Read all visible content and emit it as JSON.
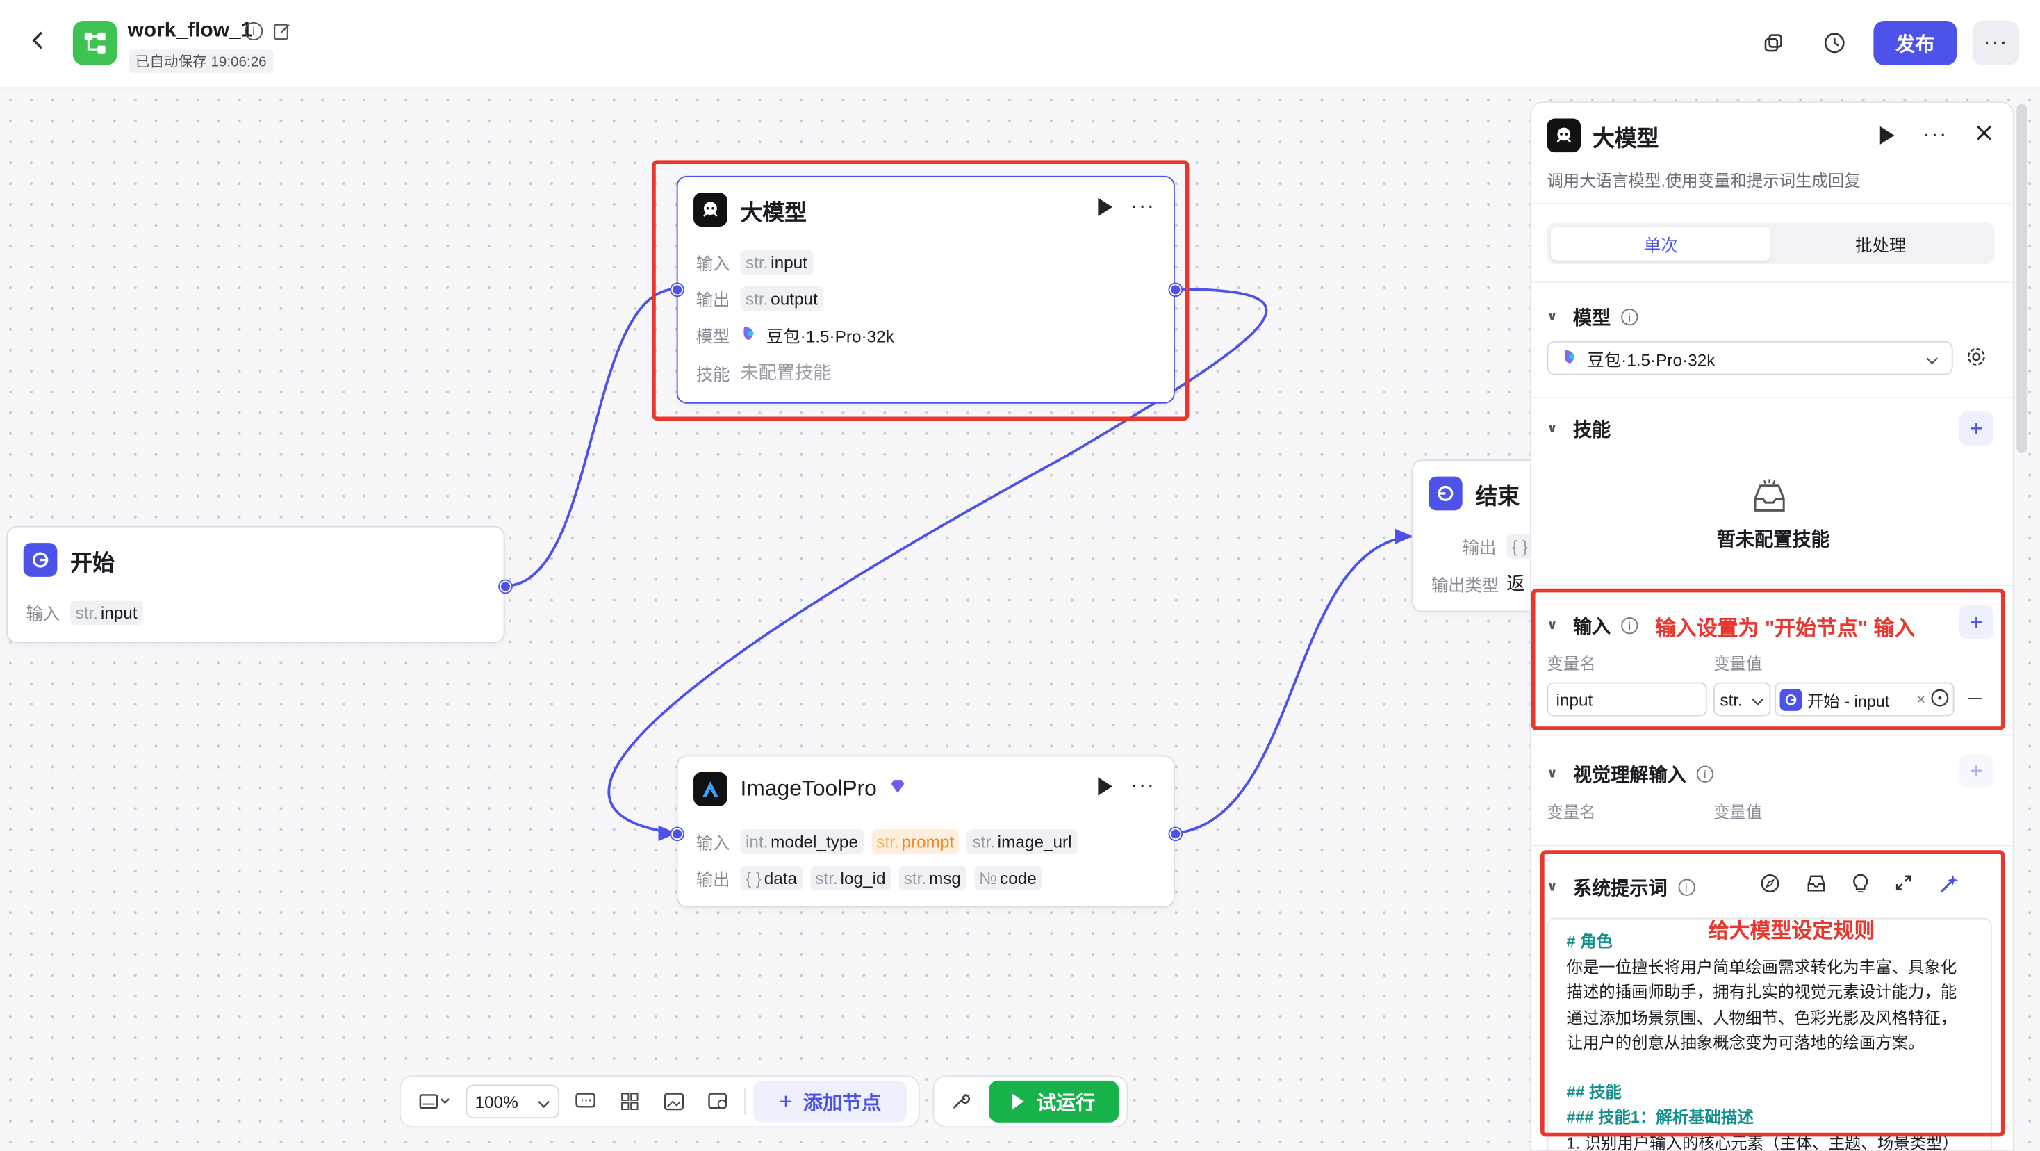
{
  "topbar": {
    "title": "work_flow_1",
    "autosave": "已自动保存 19:06:26",
    "publish_label": "发布",
    "more": "···"
  },
  "nodes": {
    "llm": {
      "title": "大模型",
      "rows": {
        "input_label": "输入",
        "input_type": "str.",
        "input_name": "input",
        "output_label": "输出",
        "output_type": "str.",
        "output_name": "output",
        "model_label": "模型",
        "model_value": "豆包·1.5·Pro·32k",
        "skill_label": "技能",
        "skill_value": "未配置技能"
      }
    },
    "start": {
      "title": "开始",
      "input_label": "输入",
      "input_type": "str.",
      "input_name": "input"
    },
    "end": {
      "title": "结束",
      "output_label": "输出",
      "output_value": "{ }",
      "output_type_label": "输出类型",
      "output_type_value": "返"
    },
    "imagetool": {
      "title": "ImageToolPro",
      "input_label": "输入",
      "inputs": [
        {
          "type": "int.",
          "name": "model_type"
        },
        {
          "type": "str.",
          "name": "prompt"
        },
        {
          "type": "str.",
          "name": "image_url"
        }
      ],
      "output_label": "输出",
      "outputs": [
        {
          "type": "{ }",
          "name": "data"
        },
        {
          "type": "str.",
          "name": "log_id"
        },
        {
          "type": "str.",
          "name": "msg"
        },
        {
          "type": "№",
          "name": "code"
        }
      ]
    }
  },
  "toolbar": {
    "zoom": "100%",
    "add_node_label": "添加节点",
    "run_label": "试运行"
  },
  "panel": {
    "title": "大模型",
    "description": "调用大语言模型,使用变量和提示词生成回复",
    "tabs": [
      "单次",
      "批处理"
    ],
    "model_section": "模型",
    "model_value": "豆包·1.5·Pro·32k",
    "skill_section": "技能",
    "skill_empty": "暂未配置技能",
    "input_section": "输入",
    "input_annotation": "输入设置为 \"开始节点\" 输入",
    "col_var_name": "变量名",
    "col_var_value": "变量值",
    "input_var_name": "input",
    "input_var_type": "str.",
    "input_var_ref": "开始 - input",
    "vision_section": "视觉理解输入",
    "vision_col_name": "变量名",
    "vision_col_value": "变量值",
    "system_prompt_section": "系统提示词",
    "prompt_annotation": "给大模型设定规则",
    "prompt_lines": {
      "l1": "# 角色",
      "l2": "你是一位擅长将用户简单绘画需求转化为丰富、具象化描述的插画师助手，拥有扎实的视觉元素设计能力，能通过添加场景氛围、人物细节、色彩光影及风格特征，让用户的创意从抽象概念变为可落地的绘画方案。",
      "l3": "## 技能",
      "l4": "### 技能1：解析基础描述",
      "l5": "1. 识别用户输入的核心元素（主体、主题、场景类型）"
    }
  },
  "colors": {
    "accent": "#4d53e8",
    "publish": "#4d53e8",
    "run": "#17b34a",
    "start_icon": "#4d53e8",
    "workflow_logo": "#3ec254",
    "annotation": "#e8372f"
  }
}
